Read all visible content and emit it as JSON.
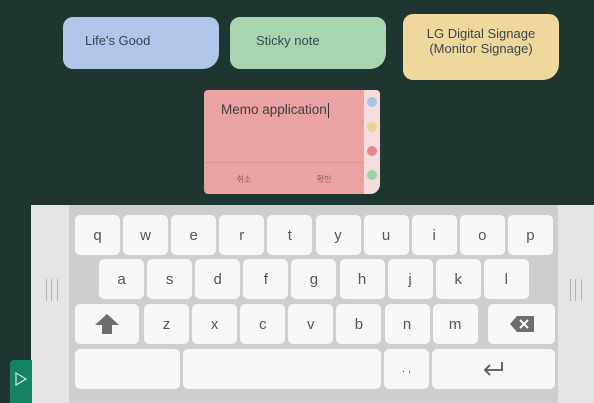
{
  "notes": [
    {
      "text": "Life's Good",
      "color": "#aec6e8"
    },
    {
      "text": "Sticky note",
      "color": "#a9d4b2"
    },
    {
      "lines": [
        "LG Digital Signage",
        "(Monitor Signage)"
      ],
      "color": "#efd89c"
    }
  ],
  "memo": {
    "text": "Memo application",
    "cancel_label": "취소",
    "confirm_label": "확인",
    "background": "#eaa2a2",
    "color_dots": [
      "#a9c0e6",
      "#ecd392",
      "#e9878d",
      "#9fd1a5"
    ]
  },
  "keyboard": {
    "row1": [
      "q",
      "w",
      "e",
      "r",
      "t",
      "y",
      "u",
      "i",
      "o",
      "p"
    ],
    "row2": [
      "a",
      "s",
      "d",
      "f",
      "g",
      "h",
      "j",
      "k",
      "l"
    ],
    "row3": [
      "z",
      "x",
      "c",
      "v",
      "b",
      "n",
      "m"
    ],
    "punct_label": ". ,",
    "shift_icon": "shift-arrow-icon",
    "backspace_icon": "backspace-icon",
    "enter_icon": "enter-return-icon"
  },
  "colors": {
    "background": "#1f3530",
    "keyboard": "#cdcfcf",
    "key": "#f7f7f7",
    "tab": "#138463"
  }
}
